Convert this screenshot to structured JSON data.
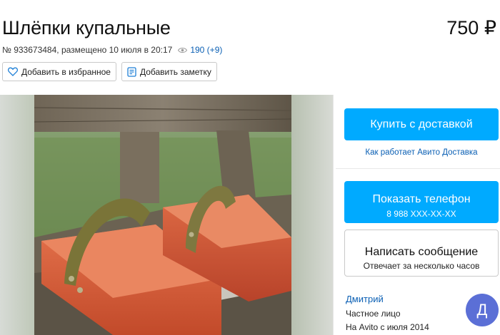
{
  "listing": {
    "title": "Шлёпки купальные",
    "price": "750 ₽",
    "meta_text": "№ 933673484, размещено 10 июля в 20:17",
    "views": "190 (+9)"
  },
  "actions": {
    "favorite_label": "Добавить в избранное",
    "note_label": "Добавить заметку"
  },
  "buy": {
    "label": "Купить с доставкой",
    "delivery_link": "Как работает Авито Доставка"
  },
  "phone": {
    "label": "Показать телефон",
    "number": "8 988 XXX-XX-XX"
  },
  "message": {
    "label": "Написать сообщение",
    "sub": "Отвечает за несколько часов"
  },
  "seller": {
    "name": "Дмитрий",
    "type": "Частное лицо",
    "since": "На Avito с июля 2014",
    "avatar_letter": "Д"
  },
  "colors": {
    "accent_blue": "#00aaff",
    "link_blue": "#0a5fb4",
    "avatar_bg": "#5b6fd6"
  },
  "icons": [
    "heart-icon",
    "note-icon",
    "eye-icon"
  ]
}
